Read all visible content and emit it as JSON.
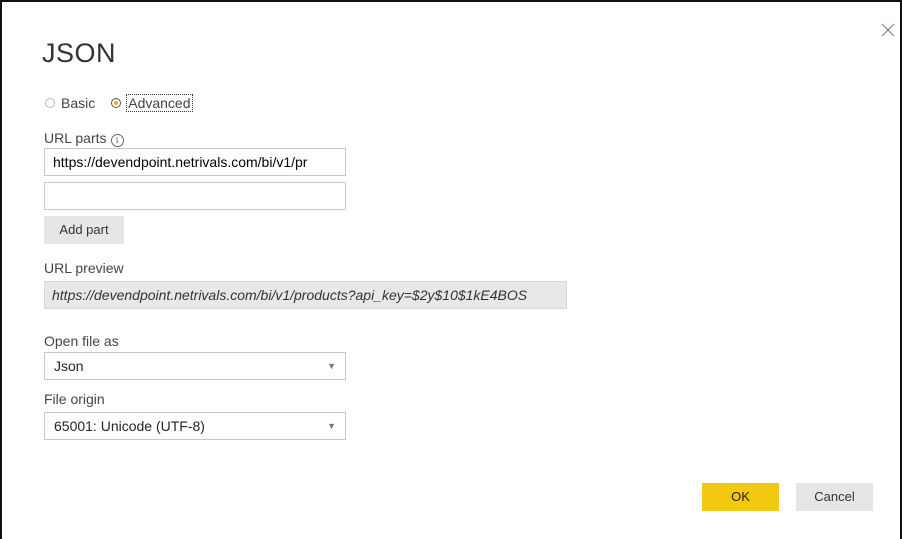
{
  "dialog": {
    "title": "JSON",
    "close_icon": "close-icon"
  },
  "mode": {
    "options": [
      {
        "label": "Basic",
        "selected": false
      },
      {
        "label": "Advanced",
        "selected": true
      }
    ]
  },
  "url_parts": {
    "label": "URL parts",
    "info_icon": "info-icon",
    "info_glyph": "i",
    "part1_value": "https://devendpoint.netrivals.com/bi/v1/pr",
    "part2_value": "",
    "add_part_label": "Add part"
  },
  "url_preview": {
    "label": "URL preview",
    "value": "https://devendpoint.netrivals.com/bi/v1/products?api_key=$2y$10$1kE4BOS"
  },
  "open_file_as": {
    "label": "Open file as",
    "selected": "Json"
  },
  "file_origin": {
    "label": "File origin",
    "selected": "65001: Unicode (UTF-8)"
  },
  "footer": {
    "ok_label": "OK",
    "cancel_label": "Cancel"
  },
  "colors": {
    "accent": "#f2c811",
    "radio_selected": "#e8b400"
  }
}
